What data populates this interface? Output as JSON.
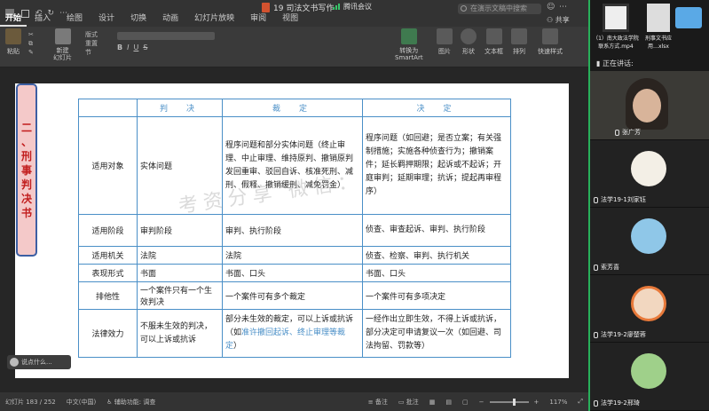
{
  "menubar": {
    "tabs": [
      "开始",
      "插入",
      "绘图",
      "设计",
      "切换",
      "动画",
      "幻灯片放映",
      "审阅",
      "视图"
    ],
    "active_tab": "开始",
    "document_title": "19 司法文书写作",
    "meeting_label": "腾讯会议",
    "search_placeholder": "在演示文稿中搜索",
    "share_label": "共享"
  },
  "ribbon": {
    "paste": "粘贴",
    "new_slide": "新建\n幻灯片",
    "layout": "版式",
    "reset": "重置",
    "section": "节",
    "convert_smartart": "转换为\nSmartArt",
    "picture": "图片",
    "shape": "形状",
    "text_box": "文本框",
    "arrange": "排列",
    "quick_styles": "快速样式"
  },
  "slide": {
    "side_label": [
      "二",
      "、",
      "刑",
      "事",
      "判",
      "决",
      "书"
    ],
    "watermark": "考资分享  微信：",
    "table": {
      "headers": [
        "判　决",
        "裁　定",
        "决　定"
      ],
      "rows": [
        {
          "label": "适用对象",
          "c1": "实体问题",
          "c2": "程序问题和部分实体问题（终止审理、中止审理、维持原判、撤销原判发回重审、驳回自诉、核准死刑、减刑、假释、撤销缓刑、减免罚金）",
          "c3": "程序问题（如回避；是否立案；有关强制措施；实施各种侦查行为；撤销案件；延长羁押期限；起诉或不起诉；开庭审判；延期审理；抗诉；提起再审程序）"
        },
        {
          "label": "适用阶段",
          "c1": "审判阶段",
          "c2": "审判、执行阶段",
          "c3": "侦查、审查起诉、审判、执行阶段"
        },
        {
          "label": "适用机关",
          "c1": "法院",
          "c2": "法院",
          "c3": "侦查、检察、审判、执行机关"
        },
        {
          "label": "表现形式",
          "c1": "书面",
          "c2": "书面、口头",
          "c3": "书面、口头"
        },
        {
          "label": "排他性",
          "c1": "一个案件只有一个生效判决",
          "c2": "一个案件可有多个裁定",
          "c3": "一个案件可有多项决定"
        },
        {
          "label": "法律效力",
          "c1": "不服未生效的判决，可以上诉或抗诉",
          "c2_a": "部分未生效的裁定，可以上诉或抗诉（如",
          "c2_b": "准许撤回起诉、终止审理等裁定",
          "c2_c": "）",
          "c3": "一经作出立即生效，不得上诉或抗诉，部分决定可申请复议一次（如回避、司法拘留、罚款等）"
        }
      ]
    }
  },
  "comment_box": "说点什么...",
  "statusbar": {
    "slide_pos": "幻灯片 183 / 252",
    "language": "中文(中国)",
    "accessibility": "辅助功能: 调查",
    "notes": "备注",
    "comments": "批注",
    "zoom": "117%"
  },
  "meeting_panel": {
    "desktop_files": [
      "（1）南大政法学院联系方式.mp4",
      "刑事文书应用…xlsx"
    ],
    "speaking_label": "正在讲话:",
    "participants": [
      {
        "name": "张广芳"
      },
      {
        "name": "法学19-1刘家钰"
      },
      {
        "name": "索芳喜"
      },
      {
        "name": "法学19-2廖楚蓉"
      },
      {
        "name": "法学19-2邢琦"
      }
    ]
  },
  "colors": {
    "accent_green": "#28b05a",
    "table_blue": "#4a8fc7",
    "side_red": "#c11d1d"
  }
}
